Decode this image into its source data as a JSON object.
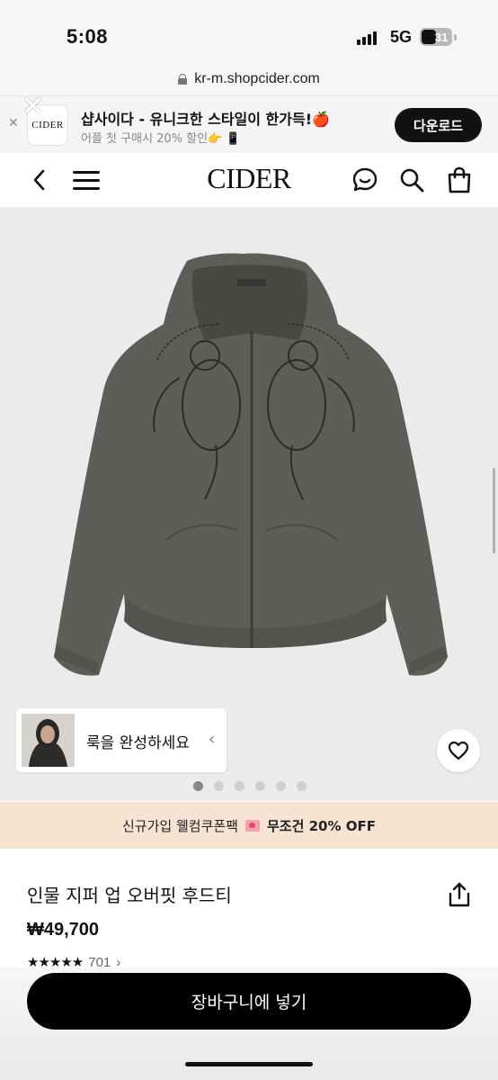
{
  "status_bar": {
    "time": "5:08",
    "network": "5G",
    "battery": "31"
  },
  "browser": {
    "url": "kr-m.shopcider.com"
  },
  "app_banner": {
    "logo_text": "CIDER",
    "title": "샵사이다 - 유니크한 스타일이 한가득!🍎",
    "subtitle": "어플 첫 구매시 20% 할인👉 📱",
    "download_label": "다운로드"
  },
  "header": {
    "logo": "CIDER",
    "icons": [
      "back-icon",
      "menu-icon",
      "chat-icon",
      "search-icon",
      "bag-icon"
    ]
  },
  "product_gallery": {
    "look_label": "룩을 완성하세요",
    "image_count": 6,
    "active_index": 0
  },
  "promo": {
    "text_before": "신규가입 웰컴쿠폰팩",
    "text_after": "무조건 20% OFF"
  },
  "product": {
    "name": "인물 지퍼 업 오버핏 후드티",
    "price": "₩49,700",
    "rating": 4.5,
    "stars": "★★★★★",
    "review_count": "701",
    "review_chevron": "›"
  },
  "cta": {
    "add_to_cart_label": "장바구니에 넣기"
  },
  "colors": {
    "accent": "#000000",
    "promo_bg": "#f6e3d1",
    "image_bg": "#ebebeb",
    "hoodie": "#5f5d59"
  }
}
